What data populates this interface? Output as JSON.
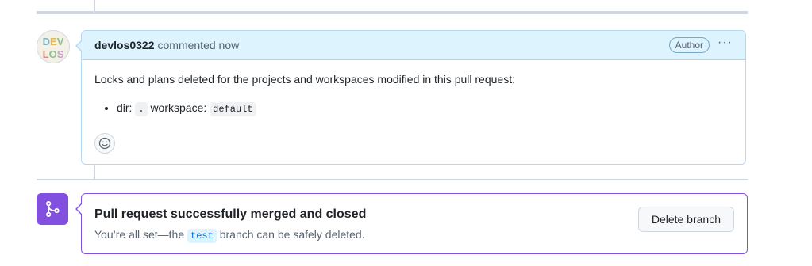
{
  "comment": {
    "author": "devlos0322",
    "meta": "commented now",
    "role_badge": "Author",
    "more_label": "···",
    "avatar_text_top": "DEV",
    "avatar_text_bottom": "LOS",
    "body_intro": "Locks and plans deleted for the projects and workspaces modified in this pull request:",
    "list_items": [
      {
        "dir_label": "dir:",
        "dir_value": ".",
        "workspace_label": "workspace:",
        "workspace_value": "default"
      }
    ],
    "reaction_icon": "smiley-icon"
  },
  "merge_event": {
    "icon": "git-merge-icon",
    "title": "Pull request successfully merged and closed",
    "desc_prefix": "You’re all set—the",
    "branch": "test",
    "desc_suffix": "branch can be safely deleted.",
    "delete_button_label": "Delete branch"
  },
  "colors": {
    "comment_header_bg": "#ddf4ff",
    "comment_border": "#b6d7f2",
    "merge_purple": "#8250df",
    "timeline_gray": "#d0d7de"
  }
}
